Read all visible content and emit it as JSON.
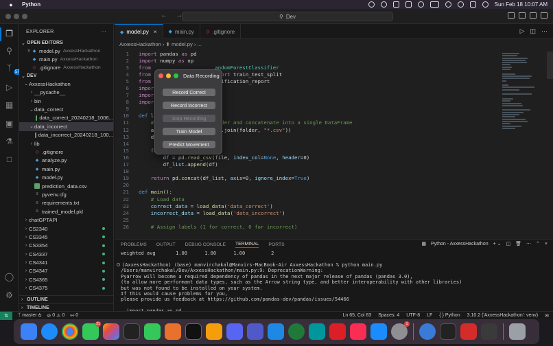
{
  "menubar": {
    "app_name": "Python",
    "datetime": "Sun Feb 18  10:07 AM"
  },
  "titlebar": {
    "search_text": "Dev"
  },
  "activity": {
    "scm_badge": "570"
  },
  "explorer": {
    "title": "EXPLORER",
    "open_editors_label": "OPEN EDITORS",
    "open_editors": [
      {
        "name": "model.py",
        "path": "AxxessHackathon",
        "close": "×"
      },
      {
        "name": "main.py",
        "path": "AxxessHackathon"
      },
      {
        "name": ".gitignore",
        "path": "AxxessHackathon"
      }
    ],
    "dev_label": "DEV",
    "tree": [
      {
        "label": "AxxessHackathon",
        "kind": "folder-open",
        "indent": 1
      },
      {
        "label": "__pycache__",
        "kind": "folder",
        "indent": 2
      },
      {
        "label": "bin",
        "kind": "folder",
        "indent": 2
      },
      {
        "label": "data_correct",
        "kind": "folder-open",
        "indent": 2
      },
      {
        "label": "data_correct_20240218_1006...",
        "kind": "csv",
        "indent": 3
      },
      {
        "label": "data_incorrect",
        "kind": "folder-open",
        "indent": 2,
        "selected": true
      },
      {
        "label": "data_incorrect_20240218_100...",
        "kind": "csv",
        "indent": 3
      },
      {
        "label": "lib",
        "kind": "folder",
        "indent": 2
      },
      {
        "label": ".gitignore",
        "kind": "git",
        "indent": 2
      },
      {
        "label": "analyze.py",
        "kind": "py",
        "indent": 2
      },
      {
        "label": "main.py",
        "kind": "py",
        "indent": 2
      },
      {
        "label": "model.py",
        "kind": "py",
        "indent": 2
      },
      {
        "label": "prediction_data.csv",
        "kind": "csv",
        "indent": 2
      },
      {
        "label": "pyvenv.cfg",
        "kind": "txt",
        "indent": 2
      },
      {
        "label": "requirements.txt",
        "kind": "txt",
        "indent": 2
      },
      {
        "label": "trained_model.pkl",
        "kind": "txt",
        "indent": 2
      },
      {
        "label": "chatGPTAPI",
        "kind": "folder",
        "indent": 1
      },
      {
        "label": "CS2340",
        "kind": "folder",
        "indent": 1,
        "dot": true
      },
      {
        "label": "CS3345",
        "kind": "folder",
        "indent": 1,
        "dot": true
      },
      {
        "label": "CS3354",
        "kind": "folder",
        "indent": 1,
        "dot": true
      },
      {
        "label": "CS4337",
        "kind": "folder",
        "indent": 1,
        "dot": true
      },
      {
        "label": "CS4341",
        "kind": "folder",
        "indent": 1,
        "dot": true
      },
      {
        "label": "CS4347",
        "kind": "folder",
        "indent": 1,
        "dot": true
      },
      {
        "label": "CS4365",
        "kind": "folder",
        "indent": 1,
        "dot": true
      },
      {
        "label": "CS4375",
        "kind": "folder",
        "indent": 1,
        "dot": true
      }
    ],
    "outline_label": "OUTLINE",
    "timeline_label": "TIMELINE"
  },
  "editor": {
    "tabs": [
      {
        "label": "model.py",
        "icon": "python-icon",
        "active": true,
        "close": "×"
      },
      {
        "label": "main.py",
        "icon": "python-icon",
        "active": false
      },
      {
        "label": ".gitignore",
        "icon": "git-icon",
        "active": false
      }
    ],
    "breadcrumb": "AxxessHackathon  ›  ⬍ model.py  ›  ...",
    "lines": [
      {
        "n": "1",
        "segs": [
          [
            "kw",
            "import"
          ],
          [
            "",
            " pandas "
          ],
          [
            "kw",
            "as"
          ],
          [
            "",
            " pd"
          ]
        ]
      },
      {
        "n": "2",
        "segs": [
          [
            "kw",
            "import"
          ],
          [
            "",
            " numpy "
          ],
          [
            "kw",
            "as"
          ],
          [
            "",
            " np"
          ]
        ]
      },
      {
        "n": "3",
        "segs": [
          [
            "kw",
            "from"
          ],
          [
            "",
            "                     "
          ],
          [
            "cls",
            "andomForestClassifier"
          ]
        ]
      },
      {
        "n": "4",
        "segs": [
          [
            "kw",
            "from"
          ],
          [
            "",
            "                     "
          ],
          [
            "kw",
            "mport"
          ],
          [
            "",
            " train_test_split"
          ]
        ]
      },
      {
        "n": "5",
        "segs": [
          [
            "kw",
            "from"
          ],
          [
            "",
            "                     "
          ],
          [
            "",
            "ssification_report"
          ]
        ]
      },
      {
        "n": "6",
        "segs": [
          [
            "kw",
            "impor"
          ]
        ]
      },
      {
        "n": "7",
        "segs": [
          [
            "kw",
            "impor"
          ]
        ]
      },
      {
        "n": "8",
        "segs": [
          [
            "kw",
            "impor"
          ]
        ]
      },
      {
        "n": "9",
        "segs": [
          [
            "",
            ""
          ]
        ]
      },
      {
        "n": "10",
        "segs": [
          [
            "kw2",
            "def"
          ],
          [
            "",
            " l"
          ]
        ]
      },
      {
        "n": "11",
        "segs": [
          [
            "cm",
            "    #                   folder and concatenate into a single DataFrame"
          ]
        ]
      },
      {
        "n": "12",
        "segs": [
          [
            "",
            "    a                   "
          ],
          [
            "fn",
            "ath.join"
          ],
          [
            "",
            "(folder, "
          ],
          [
            "str",
            "\"*.csv\""
          ],
          [
            "",
            "))"
          ]
        ]
      },
      {
        "n": "13",
        "segs": [
          [
            "",
            "    d"
          ]
        ]
      },
      {
        "n": "14",
        "segs": [
          [
            "",
            ""
          ]
        ]
      },
      {
        "n": "15",
        "segs": [
          [
            "kw",
            "    fo"
          ]
        ]
      },
      {
        "n": "16",
        "segs": [
          [
            "var",
            "        df"
          ],
          [
            "",
            " = pd."
          ],
          [
            "fn",
            "read_csv"
          ],
          [
            "",
            "(file, "
          ],
          [
            "var",
            "index_col"
          ],
          [
            "",
            "="
          ],
          [
            "kw2",
            "None"
          ],
          [
            "",
            ", "
          ],
          [
            "var",
            "header"
          ],
          [
            "",
            "=0)"
          ]
        ]
      },
      {
        "n": "17",
        "segs": [
          [
            "var",
            "        df_list"
          ],
          [
            "",
            "."
          ],
          [
            "fn",
            "append"
          ],
          [
            "",
            "(df)"
          ]
        ]
      },
      {
        "n": "18",
        "segs": [
          [
            "",
            ""
          ]
        ]
      },
      {
        "n": "19",
        "segs": [
          [
            "kw",
            "    return"
          ],
          [
            "",
            " pd."
          ],
          [
            "fn",
            "concat"
          ],
          [
            "",
            "(df_list, "
          ],
          [
            "var",
            "axis"
          ],
          [
            "",
            "=0, "
          ],
          [
            "var",
            "ignore_index"
          ],
          [
            "",
            "="
          ],
          [
            "kw2",
            "True"
          ],
          [
            "",
            ")"
          ]
        ]
      },
      {
        "n": "20",
        "segs": [
          [
            "",
            ""
          ]
        ]
      },
      {
        "n": "21",
        "segs": [
          [
            "kw2",
            "def"
          ],
          [
            "fn",
            " main"
          ],
          [
            "",
            "():"
          ]
        ]
      },
      {
        "n": "22",
        "segs": [
          [
            "cm",
            "    # Load data"
          ]
        ]
      },
      {
        "n": "23",
        "segs": [
          [
            "var",
            "    correct_data"
          ],
          [
            "",
            " = "
          ],
          [
            "fn",
            "load_data"
          ],
          [
            "",
            "("
          ],
          [
            "str",
            "'data_correct'"
          ],
          [
            "",
            ")"
          ]
        ]
      },
      {
        "n": "24",
        "segs": [
          [
            "var",
            "    incorrect_data"
          ],
          [
            "",
            " = "
          ],
          [
            "fn",
            "load_data"
          ],
          [
            "",
            "("
          ],
          [
            "str",
            "'data_incorrect'"
          ],
          [
            "",
            ")"
          ]
        ]
      },
      {
        "n": "25",
        "segs": [
          [
            "",
            ""
          ]
        ]
      },
      {
        "n": "26",
        "segs": [
          [
            "cm",
            "    # Assign labels (1 for correct, 0 for incorrect)"
          ]
        ]
      }
    ]
  },
  "dialog": {
    "title": "Data Recording",
    "buttons": [
      {
        "label": "Record Correct",
        "enabled": true
      },
      {
        "label": "Record Incorrect",
        "enabled": true
      },
      {
        "label": "Stop Recording",
        "enabled": false
      },
      {
        "label": "Train Model",
        "enabled": true
      },
      {
        "label": "Predict Movement",
        "enabled": true
      }
    ]
  },
  "panel": {
    "tabs": [
      "PROBLEMS",
      "OUTPUT",
      "DEBUG CONSOLE",
      "TERMINAL",
      "PORTS"
    ],
    "active_tab": "TERMINAL",
    "terminal_name": "Python - AxxessHackathon",
    "lines": [
      "weighted avg       1.00      1.00      1.00         2",
      "",
      "(AxxessHackathon) (base) manvirchakal@Manvirs-MacBook-Air AxxessHackathon % python main.py",
      "/Users/manvirchakal/Dev/AxxessHackathon/main.py:9: DeprecationWarning:",
      "Pyarrow will become a required dependency of pandas in the next major release of pandas (pandas 3.0),",
      "(to allow more performant data types, such as the Arrow string type, and better interoperability with other libraries)",
      "but was not found to be installed on your system.",
      "If this would cause problems for you,",
      "please provide us feedback at https://github.com/pandas-dev/pandas/issues/54466",
      "",
      "  import pandas as pd"
    ]
  },
  "statusbar": {
    "branch": "master",
    "sync": "⥁",
    "errors": "0",
    "warnings": "0",
    "ports": "0",
    "position": "Ln 65, Col 83",
    "spaces": "Spaces: 4",
    "encoding": "UTF-8",
    "eol": "LF",
    "language": "Python",
    "interpreter": "3.10.2 ('AxxessHackathon': venv)"
  },
  "dock": {
    "badges": {
      "messages": "21",
      "settings": "1"
    }
  }
}
